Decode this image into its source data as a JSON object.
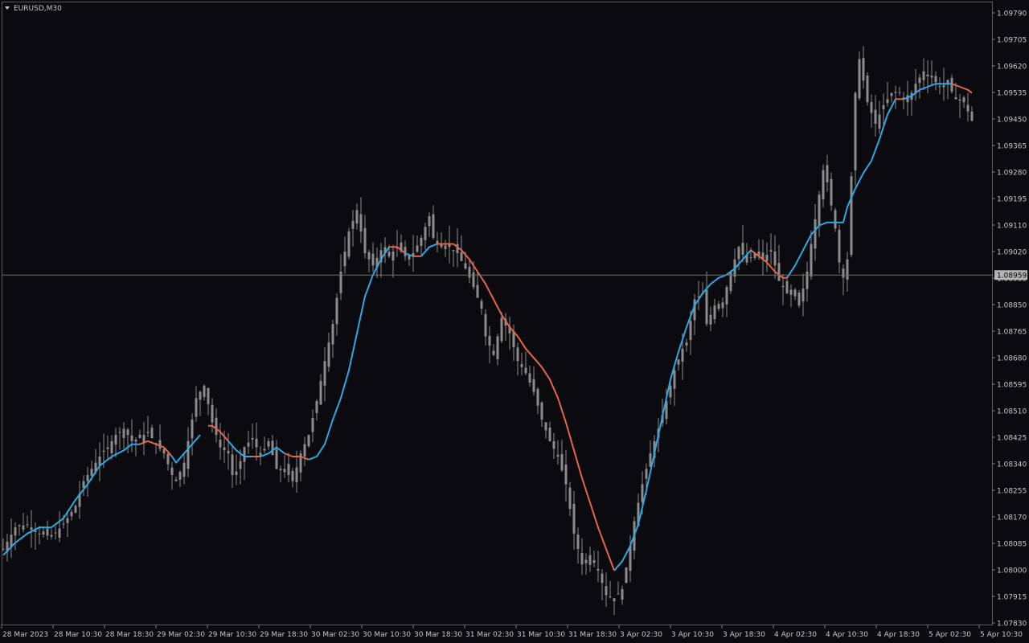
{
  "symbol_label": "EURUSD,M30",
  "current_price_label": "1.08959",
  "colors": {
    "background": "#0a0a0f",
    "candle": "#8c8c8c",
    "ma_up": "#2aa9e6",
    "ma_down": "#e7644a",
    "axis_text": "#c8c8c8",
    "crosshair": "#6e6e6e",
    "price_tag_bg": "#b4b4b4",
    "price_tag_text": "#000000"
  },
  "chart_data": {
    "type": "line",
    "symbol": "EURUSD",
    "timeframe": "M30",
    "y_range": [
      1.0783,
      1.0982
    ],
    "x_ticks": [
      "28 Mar 2023",
      "28 Mar 10:30",
      "28 Mar 18:30",
      "29 Mar 02:30",
      "29 Mar 10:30",
      "29 Mar 18:30",
      "30 Mar 02:30",
      "30 Mar 10:30",
      "30 Mar 18:30",
      "31 Mar 02:30",
      "31 Mar 10:30",
      "31 Mar 18:30",
      "3 Apr 02:30",
      "3 Apr 10:30",
      "3 Apr 18:30",
      "4 Apr 02:30",
      "4 Apr 10:30",
      "4 Apr 18:30",
      "5 Apr 02:30",
      "5 Apr 10:30"
    ],
    "y_ticks": [
      "1.09790",
      "1.09705",
      "1.09620",
      "1.09535",
      "1.09450",
      "1.09365",
      "1.09280",
      "1.09195",
      "1.09110",
      "1.09020",
      "1.08935",
      "1.08850",
      "1.08765",
      "1.08680",
      "1.08595",
      "1.08510",
      "1.08425",
      "1.08340",
      "1.08255",
      "1.08170",
      "1.08085",
      "1.08000",
      "1.07915",
      "1.07830"
    ],
    "price_path": [
      [
        0,
        1.0807
      ],
      [
        3,
        1.0814
      ],
      [
        6,
        1.0815
      ],
      [
        9,
        1.0812
      ],
      [
        12,
        1.0811
      ],
      [
        15,
        1.0815
      ],
      [
        18,
        1.0821
      ],
      [
        20,
        1.0829
      ],
      [
        22,
        1.0833
      ],
      [
        24,
        1.0837
      ],
      [
        26,
        1.084
      ],
      [
        28,
        1.0844
      ],
      [
        30,
        1.0846
      ],
      [
        32,
        1.0842
      ],
      [
        34,
        1.0843
      ],
      [
        36,
        1.0845
      ],
      [
        38,
        1.0841
      ],
      [
        40,
        1.0838
      ],
      [
        42,
        1.0831
      ],
      [
        43,
        1.0829
      ],
      [
        45,
        1.0835
      ],
      [
        46,
        1.0842
      ],
      [
        47,
        1.0849
      ],
      [
        48,
        1.0856
      ],
      [
        50,
        1.086
      ],
      [
        52,
        1.0848
      ],
      [
        54,
        1.084
      ],
      [
        56,
        1.0838
      ],
      [
        57,
        1.0831
      ],
      [
        58,
        1.0831
      ],
      [
        60,
        1.084
      ],
      [
        62,
        1.0843
      ],
      [
        64,
        1.0837
      ],
      [
        66,
        1.0842
      ],
      [
        68,
        1.0833
      ],
      [
        70,
        1.0833
      ],
      [
        72,
        1.0829
      ],
      [
        74,
        1.0838
      ],
      [
        76,
        1.0844
      ],
      [
        78,
        1.0855
      ],
      [
        80,
        1.0868
      ],
      [
        82,
        1.088
      ],
      [
        84,
        1.0897
      ],
      [
        86,
        1.091
      ],
      [
        88,
        1.0917
      ],
      [
        89,
        1.091
      ],
      [
        90,
        1.0903
      ],
      [
        92,
        1.0899
      ],
      [
        94,
        1.0904
      ],
      [
        96,
        1.0902
      ],
      [
        98,
        1.0905
      ],
      [
        100,
        1.0902
      ],
      [
        102,
        1.0903
      ],
      [
        104,
        1.0908
      ],
      [
        106,
        1.0915
      ],
      [
        107,
        1.0908
      ],
      [
        109,
        1.0906
      ],
      [
        111,
        1.0905
      ],
      [
        113,
        1.0903
      ],
      [
        115,
        1.0898
      ],
      [
        117,
        1.0892
      ],
      [
        119,
        1.0885
      ],
      [
        120,
        1.0876
      ],
      [
        122,
        1.087
      ],
      [
        124,
        1.0882
      ],
      [
        126,
        1.0877
      ],
      [
        128,
        1.0868
      ],
      [
        130,
        1.0864
      ],
      [
        132,
        1.0858
      ],
      [
        134,
        1.0849
      ],
      [
        136,
        1.0842
      ],
      [
        138,
        1.0837
      ],
      [
        140,
        1.0828
      ],
      [
        142,
        1.0812
      ],
      [
        144,
        1.0802
      ],
      [
        146,
        1.0805
      ],
      [
        148,
        1.08
      ],
      [
        150,
        1.0792
      ],
      [
        152,
        1.0791
      ],
      [
        154,
        1.0794
      ],
      [
        156,
        1.0808
      ],
      [
        157,
        1.0816
      ],
      [
        159,
        1.0828
      ],
      [
        161,
        1.0838
      ],
      [
        163,
        1.0846
      ],
      [
        165,
        1.0855
      ],
      [
        167,
        1.0865
      ],
      [
        169,
        1.0872
      ],
      [
        170,
        1.0874
      ],
      [
        172,
        1.0888
      ],
      [
        174,
        1.089
      ],
      [
        175,
        1.088
      ],
      [
        177,
        1.0886
      ],
      [
        179,
        1.0887
      ],
      [
        181,
        1.0897
      ],
      [
        183,
        1.0905
      ],
      [
        185,
        1.09
      ],
      [
        187,
        1.0903
      ],
      [
        189,
        1.0901
      ],
      [
        191,
        1.0904
      ],
      [
        193,
        1.0894
      ],
      [
        195,
        1.089
      ],
      [
        197,
        1.0889
      ],
      [
        198,
        1.0886
      ],
      [
        200,
        1.0897
      ],
      [
        201,
        1.0906
      ],
      [
        203,
        1.0922
      ],
      [
        204,
        1.093
      ],
      [
        205,
        1.0926
      ],
      [
        207,
        1.0911
      ],
      [
        208,
        1.09
      ],
      [
        209,
        1.0895
      ],
      [
        210,
        1.0901
      ],
      [
        211,
        1.0928
      ],
      [
        212,
        1.0955
      ],
      [
        213,
        1.0966
      ],
      [
        215,
        1.0952
      ],
      [
        217,
        1.0945
      ],
      [
        219,
        1.0951
      ],
      [
        221,
        1.0955
      ],
      [
        223,
        1.0955
      ],
      [
        225,
        1.0952
      ],
      [
        227,
        1.0958
      ],
      [
        229,
        1.0962
      ],
      [
        231,
        1.096
      ],
      [
        233,
        1.0957
      ],
      [
        235,
        1.0958
      ],
      [
        237,
        1.0953
      ],
      [
        239,
        1.0952
      ],
      [
        241,
        1.0946
      ]
    ],
    "series": [
      {
        "values": [
          [
            0,
            1.0805
          ],
          [
            3,
            1.0809
          ],
          [
            6,
            1.0812
          ],
          [
            9,
            1.0814
          ],
          [
            12,
            1.0814
          ],
          [
            15,
            1.0817
          ],
          [
            18,
            1.0823
          ],
          [
            21,
            1.0828
          ],
          [
            24,
            1.0834
          ],
          [
            27,
            1.0837
          ],
          [
            30,
            1.0839
          ],
          [
            32,
            1.0841
          ],
          [
            34,
            1.0841
          ],
          [
            36,
            1.0842
          ],
          [
            38,
            1.0841
          ],
          [
            40,
            1.084
          ],
          [
            42,
            1.0837
          ],
          [
            43,
            1.0835
          ],
          [
            45,
            1.0838
          ],
          [
            47,
            1.0841
          ],
          [
            49,
            1.0844
          ],
          [
            51,
            1.0847
          ],
          [
            52,
            1.0847
          ],
          [
            54,
            1.0845
          ],
          [
            56,
            1.0842
          ],
          [
            58,
            1.0839
          ],
          [
            60,
            1.0837
          ],
          [
            62,
            1.0837
          ],
          [
            64,
            1.0837
          ],
          [
            66,
            1.0838
          ],
          [
            68,
            1.084
          ],
          [
            70,
            1.0838
          ],
          [
            72,
            1.0837
          ],
          [
            74,
            1.0837
          ],
          [
            76,
            1.0836
          ],
          [
            78,
            1.0837
          ],
          [
            80,
            1.0841
          ],
          [
            82,
            1.0849
          ],
          [
            84,
            1.0856
          ],
          [
            86,
            1.0865
          ],
          [
            88,
            1.0877
          ],
          [
            90,
            1.0889
          ],
          [
            92,
            1.0896
          ],
          [
            94,
            1.0901
          ],
          [
            96,
            1.0905
          ],
          [
            98,
            1.0905
          ],
          [
            100,
            1.0903
          ],
          [
            102,
            1.0902
          ],
          [
            104,
            1.0902
          ],
          [
            106,
            1.0905
          ],
          [
            108,
            1.0906
          ],
          [
            110,
            1.0906
          ],
          [
            112,
            1.0906
          ],
          [
            114,
            1.0904
          ],
          [
            116,
            1.0901
          ],
          [
            118,
            1.0897
          ],
          [
            120,
            1.0893
          ],
          [
            122,
            1.0888
          ],
          [
            124,
            1.0883
          ],
          [
            126,
            1.0879
          ],
          [
            128,
            1.0876
          ],
          [
            130,
            1.0872
          ],
          [
            132,
            1.0869
          ],
          [
            134,
            1.0866
          ],
          [
            136,
            1.0862
          ],
          [
            138,
            1.0856
          ],
          [
            140,
            1.0848
          ],
          [
            142,
            1.0839
          ],
          [
            144,
            1.083
          ],
          [
            146,
            1.0822
          ],
          [
            148,
            1.0814
          ],
          [
            150,
            1.0807
          ],
          [
            152,
            1.08
          ],
          [
            154,
            1.0803
          ],
          [
            156,
            1.0808
          ],
          [
            158,
            1.0815
          ],
          [
            160,
            1.0826
          ],
          [
            162,
            1.0838
          ],
          [
            164,
            1.085
          ],
          [
            166,
            1.0862
          ],
          [
            168,
            1.0871
          ],
          [
            170,
            1.0879
          ],
          [
            172,
            1.0886
          ],
          [
            174,
            1.089
          ],
          [
            176,
            1.0893
          ],
          [
            178,
            1.0895
          ],
          [
            180,
            1.0896
          ],
          [
            182,
            1.0898
          ],
          [
            184,
            1.0901
          ],
          [
            186,
            1.0904
          ],
          [
            188,
            1.0902
          ],
          [
            190,
            1.09
          ],
          [
            192,
            1.0897
          ],
          [
            194,
            1.0895
          ],
          [
            195,
            1.0895
          ],
          [
            197,
            1.0899
          ],
          [
            199,
            1.0904
          ],
          [
            201,
            1.0909
          ],
          [
            203,
            1.0912
          ],
          [
            205,
            1.0913
          ],
          [
            207,
            1.0913
          ],
          [
            209,
            1.0913
          ],
          [
            210,
            1.0918
          ],
          [
            212,
            1.0924
          ],
          [
            214,
            1.0929
          ],
          [
            216,
            1.0933
          ],
          [
            218,
            1.094
          ],
          [
            220,
            1.0948
          ],
          [
            222,
            1.0953
          ],
          [
            224,
            1.0953
          ],
          [
            226,
            1.0954
          ],
          [
            228,
            1.0956
          ],
          [
            230,
            1.0957
          ],
          [
            232,
            1.0958
          ],
          [
            234,
            1.0958
          ],
          [
            236,
            1.0958
          ],
          [
            238,
            1.0957
          ],
          [
            240,
            1.0956
          ],
          [
            241,
            1.0955
          ]
        ],
        "segments": [
          {
            "from": 0,
            "to": 34,
            "color": "up"
          },
          {
            "from": 34,
            "to": 42,
            "color": "down"
          },
          {
            "from": 42,
            "to": 50,
            "color": "up"
          },
          {
            "from": 50,
            "to": 56,
            "color": "down"
          },
          {
            "from": 56,
            "to": 62,
            "color": "up"
          },
          {
            "from": 62,
            "to": 64,
            "color": "down"
          },
          {
            "from": 64,
            "to": 70,
            "color": "up"
          },
          {
            "from": 70,
            "to": 76,
            "color": "down"
          },
          {
            "from": 76,
            "to": 96,
            "color": "up"
          },
          {
            "from": 96,
            "to": 100,
            "color": "down"
          },
          {
            "from": 100,
            "to": 102,
            "color": "up"
          },
          {
            "from": 102,
            "to": 104,
            "color": "down"
          },
          {
            "from": 104,
            "to": 108,
            "color": "up"
          },
          {
            "from": 108,
            "to": 152,
            "color": "down"
          },
          {
            "from": 152,
            "to": 186,
            "color": "up"
          },
          {
            "from": 186,
            "to": 195,
            "color": "down"
          },
          {
            "from": 195,
            "to": 222,
            "color": "up"
          },
          {
            "from": 222,
            "to": 224,
            "color": "down"
          },
          {
            "from": 224,
            "to": 236,
            "color": "up"
          },
          {
            "from": 236,
            "to": 241,
            "color": "down"
          }
        ]
      }
    ],
    "current_price": 1.08959
  }
}
